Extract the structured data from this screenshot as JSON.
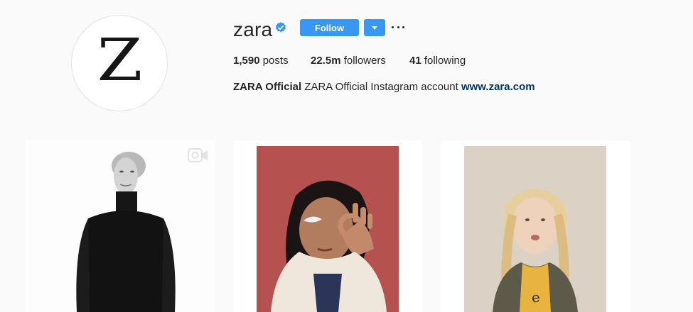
{
  "profile": {
    "avatar_letter": "Z",
    "username": "zara",
    "verified_icon": "verified-badge-icon",
    "follow_label": "Follow",
    "dropdown_icon": "caret-down-icon",
    "options_icon": "more-options-icon",
    "accent_color": "#3897f0"
  },
  "stats": {
    "posts_count": "1,590",
    "posts_label": " posts",
    "followers_count": "22.5m",
    "followers_label": " followers",
    "following_count": "41",
    "following_label": " following"
  },
  "bio": {
    "name": "ZARA Official",
    "text": " ZARA Official Instagram account ",
    "link": "www.zara.com"
  },
  "posts": [
    {
      "type": "video",
      "icon": "video-icon"
    },
    {
      "type": "photo"
    },
    {
      "type": "photo"
    }
  ]
}
